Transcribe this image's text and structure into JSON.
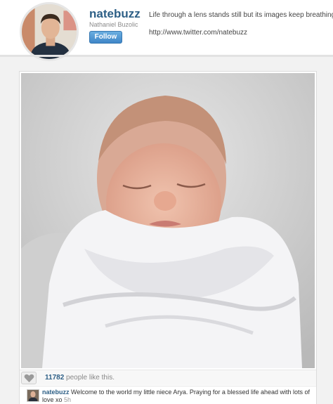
{
  "profile": {
    "username": "natebuzz",
    "full_name": "Nathaniel Buzolic",
    "follow_label": "Follow",
    "bio": "Life through a lens stands still but its images keep breathing...",
    "website": "http://www.twitter.com/natebuzz"
  },
  "post": {
    "likes_count": "11782",
    "likes_suffix": " people like this.",
    "comment": {
      "user": "natebuzz",
      "text": " Welcome to the world my little niece Arya. Praying for a blessed life ahead with lots of love xo ",
      "time": "5h"
    }
  },
  "icons": {
    "like": "heart-icon"
  },
  "colors": {
    "link_blue": "#2d5f86",
    "follow_button": "#3f86c8"
  }
}
